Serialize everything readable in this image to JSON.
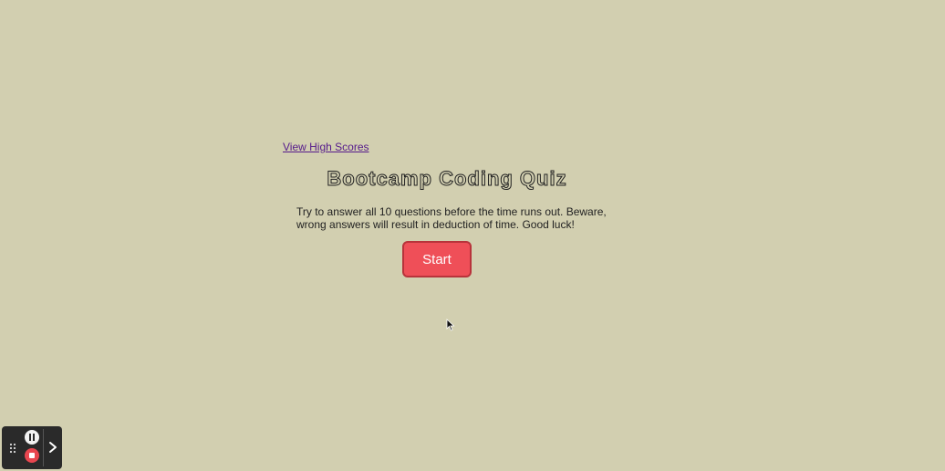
{
  "header": {
    "high_scores_link": "View High Scores"
  },
  "quiz": {
    "title": "Bootcamp Coding Quiz",
    "instructions": "Try to answer all 10 questions before the time runs out. Beware, wrong answers will result in deduction of time. Good luck!",
    "start_label": "Start"
  },
  "recorder_toolbar": {
    "icons": [
      "drag-handle-icon",
      "pause-icon",
      "stop-icon",
      "chevron-right-icon"
    ]
  },
  "colors": {
    "background": "#d2cfb0",
    "start_button": "#ef4f58",
    "link": "#551a8b"
  }
}
